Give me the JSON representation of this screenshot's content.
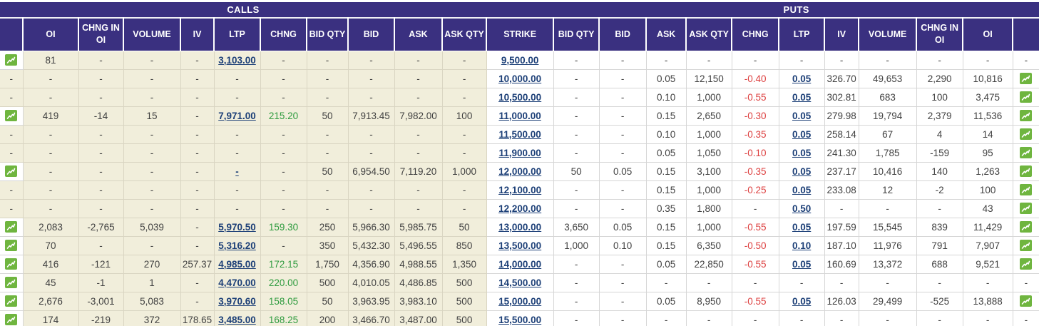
{
  "table": {
    "group_headers": {
      "calls": "CALLS",
      "puts": "PUTS"
    },
    "strike_label": "STRIKE",
    "columns_calls_labels": [
      "OI",
      "CHNG IN OI",
      "VOLUME",
      "IV",
      "LTP",
      "CHNG",
      "BID QTY",
      "BID",
      "ASK",
      "ASK QTY"
    ],
    "columns_puts_labels": [
      "BID QTY",
      "BID",
      "ASK",
      "ASK QTY",
      "CHNG",
      "LTP",
      "IV",
      "VOLUME",
      "CHNG IN OI",
      "OI"
    ],
    "column_keys_calls": [
      "oi",
      "chng_in_oi",
      "volume",
      "iv",
      "ltp",
      "chng",
      "bid_qty",
      "bid",
      "ask",
      "ask_qty"
    ],
    "column_keys_puts": [
      "bid_qty",
      "bid",
      "ask",
      "ask_qty",
      "chng",
      "ltp",
      "iv",
      "volume",
      "chng_in_oi",
      "oi"
    ],
    "rows": [
      {
        "strike": "9,500.00",
        "calls": {
          "icon": true,
          "oi": "81",
          "chng_in_oi": "-",
          "volume": "-",
          "iv": "-",
          "ltp": "3,103.00",
          "ltp_link": true,
          "chng": "-",
          "bid_qty": "-",
          "bid": "-",
          "ask": "-",
          "ask_qty": "-"
        },
        "puts": {
          "bid_qty": "-",
          "bid": "-",
          "ask": "-",
          "ask_qty": "-",
          "chng": "-",
          "ltp": "-",
          "ltp_link": false,
          "iv": "-",
          "volume": "-",
          "chng_in_oi": "-",
          "oi": "-",
          "icon": false
        }
      },
      {
        "strike": "10,000.00",
        "calls": {
          "icon": false,
          "oi": "-",
          "chng_in_oi": "-",
          "volume": "-",
          "iv": "-",
          "ltp": "-",
          "ltp_link": false,
          "chng": "-",
          "bid_qty": "-",
          "bid": "-",
          "ask": "-",
          "ask_qty": "-"
        },
        "puts": {
          "bid_qty": "-",
          "bid": "-",
          "ask": "0.05",
          "ask_qty": "12,150",
          "chng": "-0.40",
          "ltp": "0.05",
          "ltp_link": true,
          "iv": "326.70",
          "volume": "49,653",
          "chng_in_oi": "2,290",
          "oi": "10,816",
          "icon": true
        }
      },
      {
        "strike": "10,500.00",
        "calls": {
          "icon": false,
          "oi": "-",
          "chng_in_oi": "-",
          "volume": "-",
          "iv": "-",
          "ltp": "-",
          "ltp_link": false,
          "chng": "-",
          "bid_qty": "-",
          "bid": "-",
          "ask": "-",
          "ask_qty": "-"
        },
        "puts": {
          "bid_qty": "-",
          "bid": "-",
          "ask": "0.10",
          "ask_qty": "1,000",
          "chng": "-0.55",
          "ltp": "0.05",
          "ltp_link": true,
          "iv": "302.81",
          "volume": "683",
          "chng_in_oi": "100",
          "oi": "3,475",
          "icon": true
        }
      },
      {
        "strike": "11,000.00",
        "calls": {
          "icon": true,
          "oi": "419",
          "chng_in_oi": "-14",
          "volume": "15",
          "iv": "-",
          "ltp": "7,971.00",
          "ltp_link": true,
          "chng": "215.20",
          "bid_qty": "50",
          "bid": "7,913.45",
          "ask": "7,982.00",
          "ask_qty": "100"
        },
        "puts": {
          "bid_qty": "-",
          "bid": "-",
          "ask": "0.15",
          "ask_qty": "2,650",
          "chng": "-0.30",
          "ltp": "0.05",
          "ltp_link": true,
          "iv": "279.98",
          "volume": "19,794",
          "chng_in_oi": "2,379",
          "oi": "11,536",
          "icon": true
        }
      },
      {
        "strike": "11,500.00",
        "calls": {
          "icon": false,
          "oi": "-",
          "chng_in_oi": "-",
          "volume": "-",
          "iv": "-",
          "ltp": "-",
          "ltp_link": false,
          "chng": "-",
          "bid_qty": "-",
          "bid": "-",
          "ask": "-",
          "ask_qty": "-"
        },
        "puts": {
          "bid_qty": "-",
          "bid": "-",
          "ask": "0.10",
          "ask_qty": "1,000",
          "chng": "-0.35",
          "ltp": "0.05",
          "ltp_link": true,
          "iv": "258.14",
          "volume": "67",
          "chng_in_oi": "4",
          "oi": "14",
          "icon": true
        }
      },
      {
        "strike": "11,900.00",
        "calls": {
          "icon": false,
          "oi": "-",
          "chng_in_oi": "-",
          "volume": "-",
          "iv": "-",
          "ltp": "-",
          "ltp_link": false,
          "chng": "-",
          "bid_qty": "-",
          "bid": "-",
          "ask": "-",
          "ask_qty": "-"
        },
        "puts": {
          "bid_qty": "-",
          "bid": "-",
          "ask": "0.05",
          "ask_qty": "1,050",
          "chng": "-0.10",
          "ltp": "0.05",
          "ltp_link": true,
          "iv": "241.30",
          "volume": "1,785",
          "chng_in_oi": "-159",
          "oi": "95",
          "icon": true
        }
      },
      {
        "strike": "12,000.00",
        "calls": {
          "icon": true,
          "oi": "-",
          "chng_in_oi": "-",
          "volume": "-",
          "iv": "-",
          "ltp": "-",
          "ltp_link": true,
          "chng": "-",
          "bid_qty": "50",
          "bid": "6,954.50",
          "ask": "7,119.20",
          "ask_qty": "1,000"
        },
        "puts": {
          "bid_qty": "50",
          "bid": "0.05",
          "ask": "0.15",
          "ask_qty": "3,100",
          "chng": "-0.35",
          "ltp": "0.05",
          "ltp_link": true,
          "iv": "237.17",
          "volume": "10,416",
          "chng_in_oi": "140",
          "oi": "1,263",
          "icon": true
        }
      },
      {
        "strike": "12,100.00",
        "calls": {
          "icon": false,
          "oi": "-",
          "chng_in_oi": "-",
          "volume": "-",
          "iv": "-",
          "ltp": "-",
          "ltp_link": false,
          "chng": "-",
          "bid_qty": "-",
          "bid": "-",
          "ask": "-",
          "ask_qty": "-"
        },
        "puts": {
          "bid_qty": "-",
          "bid": "-",
          "ask": "0.15",
          "ask_qty": "1,000",
          "chng": "-0.25",
          "ltp": "0.05",
          "ltp_link": true,
          "iv": "233.08",
          "volume": "12",
          "chng_in_oi": "-2",
          "oi": "100",
          "icon": true
        }
      },
      {
        "strike": "12,200.00",
        "calls": {
          "icon": false,
          "oi": "-",
          "chng_in_oi": "-",
          "volume": "-",
          "iv": "-",
          "ltp": "-",
          "ltp_link": false,
          "chng": "-",
          "bid_qty": "-",
          "bid": "-",
          "ask": "-",
          "ask_qty": "-"
        },
        "puts": {
          "bid_qty": "-",
          "bid": "-",
          "ask": "0.35",
          "ask_qty": "1,800",
          "chng": "-",
          "ltp": "0.50",
          "ltp_link": true,
          "iv": "-",
          "volume": "-",
          "chng_in_oi": "-",
          "oi": "43",
          "icon": true
        }
      },
      {
        "strike": "13,000.00",
        "calls": {
          "icon": true,
          "oi": "2,083",
          "chng_in_oi": "-2,765",
          "volume": "5,039",
          "iv": "-",
          "ltp": "5,970.50",
          "ltp_link": true,
          "chng": "159.30",
          "bid_qty": "250",
          "bid": "5,966.30",
          "ask": "5,985.75",
          "ask_qty": "50"
        },
        "puts": {
          "bid_qty": "3,650",
          "bid": "0.05",
          "ask": "0.15",
          "ask_qty": "1,000",
          "chng": "-0.55",
          "ltp": "0.05",
          "ltp_link": true,
          "iv": "197.59",
          "volume": "15,545",
          "chng_in_oi": "839",
          "oi": "11,429",
          "icon": true
        }
      },
      {
        "strike": "13,500.00",
        "calls": {
          "icon": true,
          "oi": "70",
          "chng_in_oi": "-",
          "volume": "-",
          "iv": "-",
          "ltp": "5,316.20",
          "ltp_link": true,
          "chng": "-",
          "bid_qty": "350",
          "bid": "5,432.30",
          "ask": "5,496.55",
          "ask_qty": "850"
        },
        "puts": {
          "bid_qty": "1,000",
          "bid": "0.10",
          "ask": "0.15",
          "ask_qty": "6,350",
          "chng": "-0.50",
          "ltp": "0.10",
          "ltp_link": true,
          "iv": "187.10",
          "volume": "11,976",
          "chng_in_oi": "791",
          "oi": "7,907",
          "icon": true
        }
      },
      {
        "strike": "14,000.00",
        "calls": {
          "icon": true,
          "oi": "416",
          "chng_in_oi": "-121",
          "volume": "270",
          "iv": "257.37",
          "ltp": "4,985.00",
          "ltp_link": true,
          "chng": "172.15",
          "bid_qty": "1,750",
          "bid": "4,356.90",
          "ask": "4,988.55",
          "ask_qty": "1,350"
        },
        "puts": {
          "bid_qty": "-",
          "bid": "-",
          "ask": "0.05",
          "ask_qty": "22,850",
          "chng": "-0.55",
          "ltp": "0.05",
          "ltp_link": true,
          "iv": "160.69",
          "volume": "13,372",
          "chng_in_oi": "688",
          "oi": "9,521",
          "icon": true
        }
      },
      {
        "strike": "14,500.00",
        "calls": {
          "icon": true,
          "oi": "45",
          "chng_in_oi": "-1",
          "volume": "1",
          "iv": "-",
          "ltp": "4,470.00",
          "ltp_link": true,
          "chng": "220.00",
          "bid_qty": "500",
          "bid": "4,010.05",
          "ask": "4,486.85",
          "ask_qty": "500"
        },
        "puts": {
          "bid_qty": "-",
          "bid": "-",
          "ask": "-",
          "ask_qty": "-",
          "chng": "-",
          "ltp": "-",
          "ltp_link": false,
          "iv": "-",
          "volume": "-",
          "chng_in_oi": "-",
          "oi": "-",
          "icon": false
        }
      },
      {
        "strike": "15,000.00",
        "calls": {
          "icon": true,
          "oi": "2,676",
          "chng_in_oi": "-3,001",
          "volume": "5,083",
          "iv": "-",
          "ltp": "3,970.60",
          "ltp_link": true,
          "chng": "158.05",
          "bid_qty": "50",
          "bid": "3,963.95",
          "ask": "3,983.10",
          "ask_qty": "500"
        },
        "puts": {
          "bid_qty": "-",
          "bid": "-",
          "ask": "0.05",
          "ask_qty": "8,950",
          "chng": "-0.55",
          "ltp": "0.05",
          "ltp_link": true,
          "iv": "126.03",
          "volume": "29,499",
          "chng_in_oi": "-525",
          "oi": "13,888",
          "icon": true
        }
      },
      {
        "strike": "15,500.00",
        "calls": {
          "icon": true,
          "oi": "174",
          "chng_in_oi": "-219",
          "volume": "372",
          "iv": "178.65",
          "ltp": "3,485.00",
          "ltp_link": true,
          "chng": "168.25",
          "bid_qty": "200",
          "bid": "3,466.70",
          "ask": "3,487.00",
          "ask_qty": "500"
        },
        "puts": {
          "bid_qty": "-",
          "bid": "-",
          "ask": "-",
          "ask_qty": "-",
          "chng": "-",
          "ltp": "-",
          "ltp_link": false,
          "iv": "-",
          "volume": "-",
          "chng_in_oi": "-",
          "oi": "-",
          "icon": false
        }
      }
    ]
  },
  "icons": {
    "trend": "trend-chart-icon"
  },
  "colors": {
    "header_purple": "#3a3080",
    "calls_beige": "#f1eedb",
    "positive_green": "#2e9b3e",
    "negative_red": "#dd4040",
    "link_navy": "#1c3f77",
    "icon_green": "#6fb53f"
  }
}
